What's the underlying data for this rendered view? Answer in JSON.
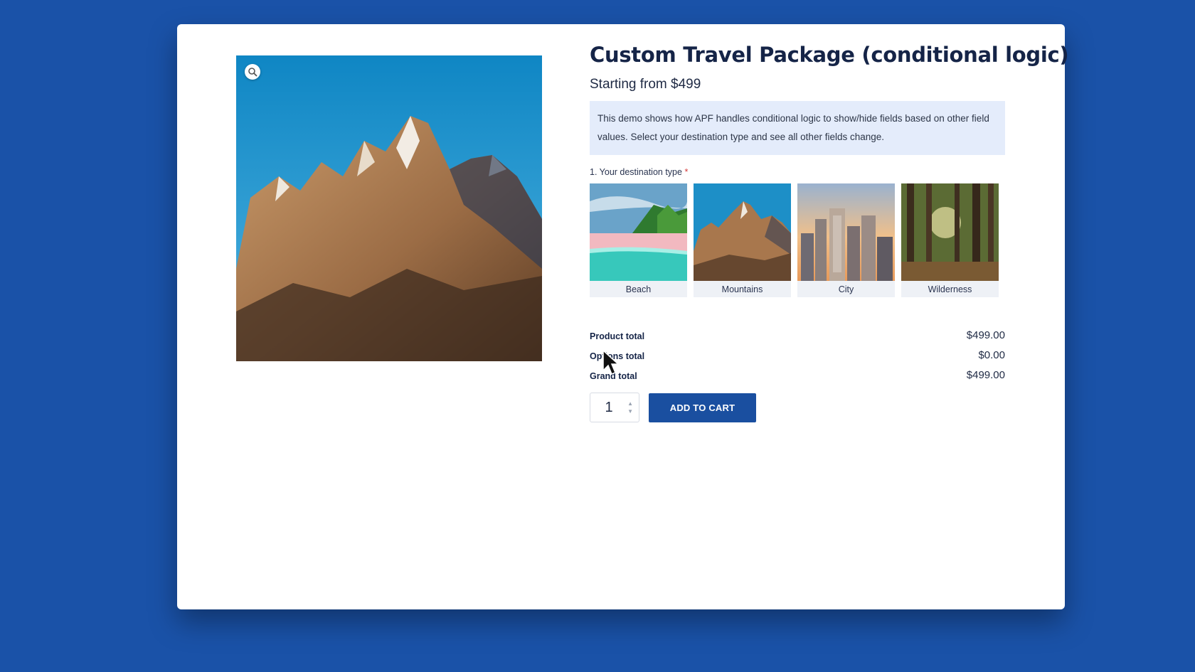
{
  "product": {
    "title": "Custom Travel Package (conditional logic)",
    "price_text": "Starting from $499",
    "notice": "This demo shows how APF handles conditional logic to show/hide fields based on other field values. Select your destination type and see all other fields change."
  },
  "gallery": {
    "zoom_icon": "magnifier-icon"
  },
  "destination_field": {
    "label": "1. Your destination type",
    "required_mark": "*",
    "options": [
      {
        "label": "Beach"
      },
      {
        "label": "Mountains"
      },
      {
        "label": "City"
      },
      {
        "label": "Wilderness"
      }
    ]
  },
  "totals": {
    "product_total_label": "Product total",
    "product_total_value": "$499.00",
    "options_total_label": "Options total",
    "options_total_value": "$0.00",
    "grand_total_label": "Grand total",
    "grand_total_value": "$499.00"
  },
  "cart": {
    "quantity": "1",
    "add_to_cart_label": "ADD TO CART"
  },
  "colors": {
    "background": "#1a52a8",
    "accent": "#1a4fa0",
    "notice_bg": "#e4ecfb",
    "title": "#152447"
  }
}
